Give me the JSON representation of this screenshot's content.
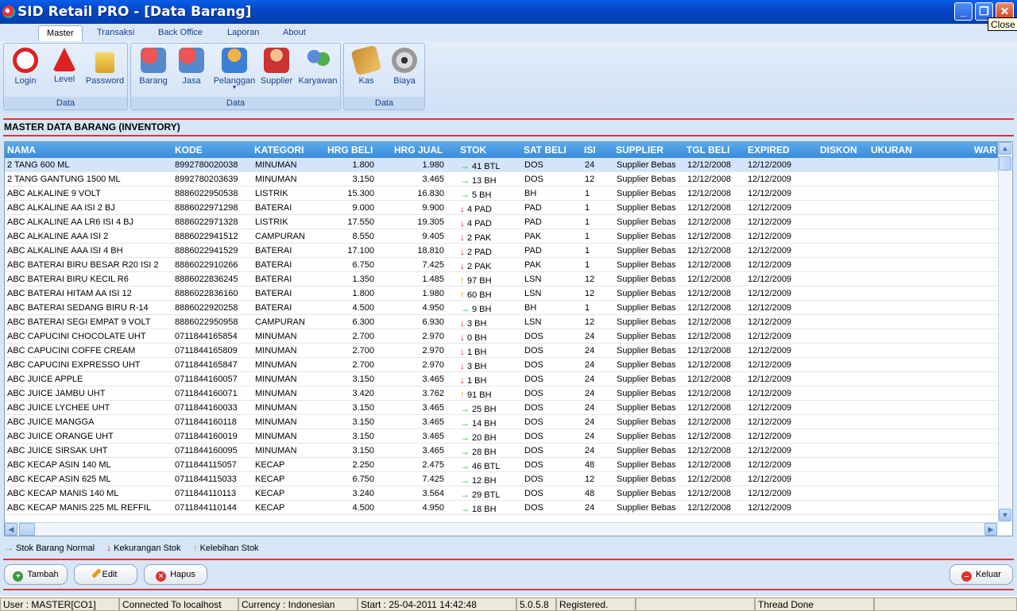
{
  "window": {
    "title": "SID Retail PRO - [Data Barang]",
    "min": "_",
    "max": "❐",
    "close": "✕",
    "close_tooltip": "Close"
  },
  "menu_tabs": [
    "Master",
    "Transaksi",
    "Back Office",
    "Laporan",
    "About"
  ],
  "ribbon": {
    "group1": {
      "label": "Data",
      "buttons": [
        "Login",
        "Level",
        "Password"
      ]
    },
    "group2": {
      "label": "Data",
      "buttons": [
        "Barang",
        "Jasa",
        "Pelanggan",
        "Supplier",
        "Karyawan"
      ]
    },
    "group3": {
      "label": "Data",
      "buttons": [
        "Kas",
        "Biaya"
      ]
    }
  },
  "page_title": "MASTER DATA BARANG (INVENTORY)",
  "columns": [
    "NAMA",
    "KODE",
    "KATEGORI",
    "HRG BELI",
    "HRG JUAL",
    "STOK",
    "SAT BELI",
    "ISI",
    "SUPPLIER",
    "TGL BELI",
    "EXPIRED",
    "DISKON",
    "UKURAN",
    "WAR"
  ],
  "rows": [
    [
      "2 TANG 600 ML",
      "8992780020038",
      "MINUMAN",
      "1.800",
      "1.980",
      "normal",
      "41 BTL",
      "DOS",
      "24",
      "Supplier Bebas",
      "12/12/2008",
      "12/12/2009"
    ],
    [
      "2 TANG GANTUNG 1500 ML",
      "8992780203639",
      "MINUMAN",
      "3.150",
      "3.465",
      "normal",
      "13 BH",
      "DOS",
      "12",
      "Supplier Bebas",
      "12/12/2008",
      "12/12/2009"
    ],
    [
      "ABC ALKALINE 9 VOLT",
      "8886022950538",
      "LISTRIK",
      "15.300",
      "16.830",
      "normal",
      "5 BH",
      "BH",
      "1",
      "Supplier Bebas",
      "12/12/2008",
      "12/12/2009"
    ],
    [
      "ABC ALKALINE AA ISI 2 BJ",
      "8886022971298",
      "BATERAI",
      "9.000",
      "9.900",
      "kurang",
      "4 PAD",
      "PAD",
      "1",
      "Supplier Bebas",
      "12/12/2008",
      "12/12/2009"
    ],
    [
      "ABC ALKALINE AA LR6 ISI 4 BJ",
      "8886022971328",
      "LISTRIK",
      "17.550",
      "19.305",
      "kurang",
      "4 PAD",
      "PAD",
      "1",
      "Supplier Bebas",
      "12/12/2008",
      "12/12/2009"
    ],
    [
      "ABC ALKALINE AAA ISI 2",
      "8886022941512",
      "CAMPURAN",
      "8.550",
      "9.405",
      "kurang",
      "2 PAK",
      "PAK",
      "1",
      "Supplier Bebas",
      "12/12/2008",
      "12/12/2009"
    ],
    [
      "ABC ALKALINE AAA ISI 4 BH",
      "8886022941529",
      "BATERAI",
      "17.100",
      "18.810",
      "kurang",
      "2 PAD",
      "PAD",
      "1",
      "Supplier Bebas",
      "12/12/2008",
      "12/12/2009"
    ],
    [
      "ABC BATERAI BIRU BESAR R20 ISI 2",
      "8886022910266",
      "BATERAI",
      "6.750",
      "7.425",
      "kurang",
      "2 PAK",
      "PAK",
      "1",
      "Supplier Bebas",
      "12/12/2008",
      "12/12/2009"
    ],
    [
      "ABC BATERAI BIRU KECIL R6",
      "8886022836245",
      "BATERAI",
      "1.350",
      "1.485",
      "lebih",
      "97 BH",
      "LSN",
      "12",
      "Supplier Bebas",
      "12/12/2008",
      "12/12/2009"
    ],
    [
      "ABC BATERAI HITAM AA ISI 12",
      "8886022836160",
      "BATERAI",
      "1.800",
      "1.980",
      "lebih",
      "60 BH",
      "LSN",
      "12",
      "Supplier Bebas",
      "12/12/2008",
      "12/12/2009"
    ],
    [
      "ABC BATERAI SEDANG BIRU R-14",
      "8886022920258",
      "BATERAI",
      "4.500",
      "4.950",
      "normal",
      "9 BH",
      "BH",
      "1",
      "Supplier Bebas",
      "12/12/2008",
      "12/12/2009"
    ],
    [
      "ABC BATERAI SEGI EMPAT 9 VOLT",
      "8886022950958",
      "CAMPURAN",
      "6.300",
      "6.930",
      "kurang",
      "3 BH",
      "LSN",
      "12",
      "Supplier Bebas",
      "12/12/2008",
      "12/12/2009"
    ],
    [
      "ABC CAPUCINI CHOCOLATE UHT",
      "0711844165854",
      "MINUMAN",
      "2.700",
      "2.970",
      "kurang",
      "0 BH",
      "DOS",
      "24",
      "Supplier Bebas",
      "12/12/2008",
      "12/12/2009"
    ],
    [
      "ABC CAPUCINI COFFE CREAM",
      "0711844165809",
      "MINUMAN",
      "2.700",
      "2.970",
      "kurang",
      "1 BH",
      "DOS",
      "24",
      "Supplier Bebas",
      "12/12/2008",
      "12/12/2009"
    ],
    [
      "ABC CAPUCINI EXPRESSO UHT",
      "0711844165847",
      "MINUMAN",
      "2.700",
      "2.970",
      "kurang",
      "3 BH",
      "DOS",
      "24",
      "Supplier Bebas",
      "12/12/2008",
      "12/12/2009"
    ],
    [
      "ABC JUICE APPLE",
      "0711844160057",
      "MINUMAN",
      "3.150",
      "3.465",
      "kurang",
      "1 BH",
      "DOS",
      "24",
      "Supplier Bebas",
      "12/12/2008",
      "12/12/2009"
    ],
    [
      "ABC JUICE JAMBU UHT",
      "0711844160071",
      "MINUMAN",
      "3.420",
      "3.762",
      "lebih",
      "91 BH",
      "DOS",
      "24",
      "Supplier Bebas",
      "12/12/2008",
      "12/12/2009"
    ],
    [
      "ABC JUICE LYCHEE UHT",
      "0711844160033",
      "MINUMAN",
      "3.150",
      "3.465",
      "normal",
      "25 BH",
      "DOS",
      "24",
      "Supplier Bebas",
      "12/12/2008",
      "12/12/2009"
    ],
    [
      "ABC JUICE MANGGA",
      "0711844160118",
      "MINUMAN",
      "3.150",
      "3.465",
      "normal",
      "14 BH",
      "DOS",
      "24",
      "Supplier Bebas",
      "12/12/2008",
      "12/12/2009"
    ],
    [
      "ABC JUICE ORANGE UHT",
      "0711844160019",
      "MINUMAN",
      "3.150",
      "3.465",
      "normal",
      "20 BH",
      "DOS",
      "24",
      "Supplier Bebas",
      "12/12/2008",
      "12/12/2009"
    ],
    [
      "ABC JUICE SIRSAK UHT",
      "0711844160095",
      "MINUMAN",
      "3.150",
      "3.465",
      "normal",
      "28 BH",
      "DOS",
      "24",
      "Supplier Bebas",
      "12/12/2008",
      "12/12/2009"
    ],
    [
      "ABC KECAP ASIN 140 ML",
      "0711844115057",
      "KECAP",
      "2.250",
      "2.475",
      "normal",
      "46 BTL",
      "DOS",
      "48",
      "Supplier Bebas",
      "12/12/2008",
      "12/12/2009"
    ],
    [
      "ABC KECAP ASIN 625 ML",
      "0711844115033",
      "KECAP",
      "6.750",
      "7.425",
      "normal",
      "12 BH",
      "DOS",
      "12",
      "Supplier Bebas",
      "12/12/2008",
      "12/12/2009"
    ],
    [
      "ABC KECAP MANIS 140 ML",
      "0711844110113",
      "KECAP",
      "3.240",
      "3.564",
      "normal",
      "29 BTL",
      "DOS",
      "48",
      "Supplier Bebas",
      "12/12/2008",
      "12/12/2009"
    ],
    [
      "ABC KECAP MANIS 225 ML REFFIL",
      "0711844110144",
      "KECAP",
      "4.500",
      "4.950",
      "normal",
      "18 BH",
      "DOS",
      "24",
      "Supplier Bebas",
      "12/12/2008",
      "12/12/2009"
    ]
  ],
  "legend": {
    "normal": "Stok Barang Normal",
    "kurang": "Kekurangan Stok",
    "lebih": "Kelebihan Stok"
  },
  "buttons": {
    "tambah": "Tambah",
    "edit": "Edit",
    "hapus": "Hapus",
    "keluar": "Keluar"
  },
  "status": [
    "User : MASTER[CO1]",
    "Connected To localhost",
    "Currency : Indonesian",
    "Start  : 25-04-2011 14:42:48",
    "5.0.5.8",
    "Registered.",
    "",
    "Thread Done",
    ""
  ]
}
